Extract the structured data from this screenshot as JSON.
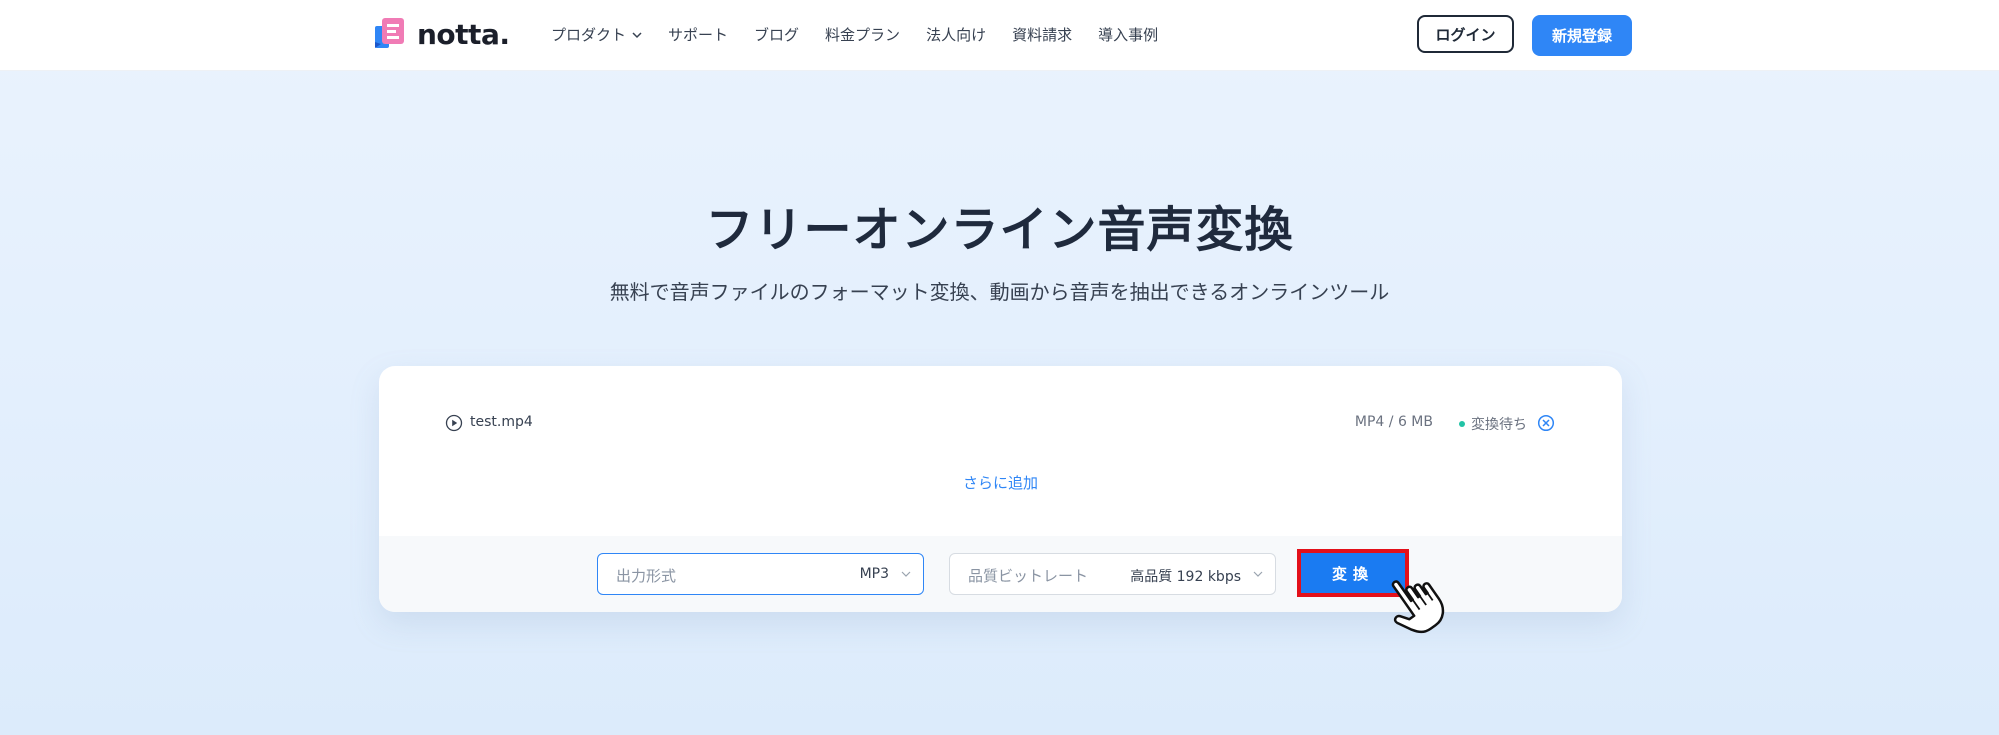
{
  "header": {
    "brand": "notta.",
    "nav": [
      {
        "label": "プロダクト",
        "has_dropdown": true
      },
      {
        "label": "サポート"
      },
      {
        "label": "ブログ"
      },
      {
        "label": "料金プラン"
      },
      {
        "label": "法人向け"
      },
      {
        "label": "資料請求"
      },
      {
        "label": "導入事例"
      }
    ],
    "login_label": "ログイン",
    "signup_label": "新規登録"
  },
  "hero": {
    "title": "フリーオンライン音声変換",
    "subtitle": "無料で音声ファイルのフォーマット変換、動画から音声を抽出できるオンラインツール"
  },
  "converter": {
    "file": {
      "name": "test.mp4",
      "meta": "MP4 / 6 MB",
      "status": "変換待ち"
    },
    "add_more_label": "さらに追加",
    "output_format": {
      "label": "出力形式",
      "value": "MP3"
    },
    "bitrate": {
      "label": "品質ビットレート",
      "value": "高品質 192 kbps"
    },
    "convert_label": "変換"
  },
  "colors": {
    "accent": "#2f86f6",
    "convert_button": "#1a7bf2",
    "highlight_border": "#e3101a",
    "status_dot": "#22c3a6"
  },
  "icons": {
    "logo": "notta-logo-icon",
    "play": "play-circle-icon",
    "remove": "close-circle-icon",
    "dropdown": "chevron-down-icon",
    "cursor": "hand-pointer-icon"
  }
}
